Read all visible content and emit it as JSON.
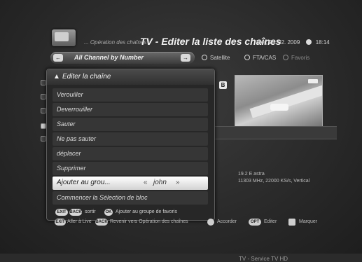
{
  "header": {
    "breadcrumb": "... Opération des chaînes >",
    "title": "TV - Editer la liste des chaînes",
    "date": "Mer, 25. 02. 2009",
    "time": "18:14"
  },
  "filter": {
    "active_label": "All Channel by Number",
    "options": [
      "Satellite",
      "FTA/CAS",
      "Favoris"
    ]
  },
  "menu": {
    "title": "Editer la chaîne",
    "items": [
      "Verouiller",
      "Deverrouiller",
      "Sauter",
      "Ne pas sauter",
      "déplacer",
      "Supprimer",
      "Ajouter au grou...",
      "Commencer la Sélection de bloc"
    ],
    "selected_value": "john",
    "hints": {
      "exit_key": "EXIT",
      "back_key": "BACK",
      "exit_text": "sortir",
      "ok_key": "OK",
      "ok_text": "Ajouter au groupe de favoris"
    }
  },
  "side": {
    "badge": "B",
    "channel_name": "TV - Service TV HD",
    "sat_line1": "19.2 E astra",
    "sat_line2": "11303 MHz, 22000 KS/s, Vertical"
  },
  "footer": {
    "exit_key": "EXIT",
    "exit_text": "Aller à Live",
    "back_key": "BACK",
    "back_text": "Revenir vers Opération des chaînes",
    "accord_text": "Accorder",
    "edit_key": "OPT",
    "edit_text": "Editer",
    "mark_key": "B",
    "mark_text": "Marquer"
  },
  "icons": {
    "header": "tv-icon",
    "menu": "warning-triangle-icon",
    "left_arrow": "arrow-left-icon",
    "right_arrow": "arrow-right-icon"
  }
}
